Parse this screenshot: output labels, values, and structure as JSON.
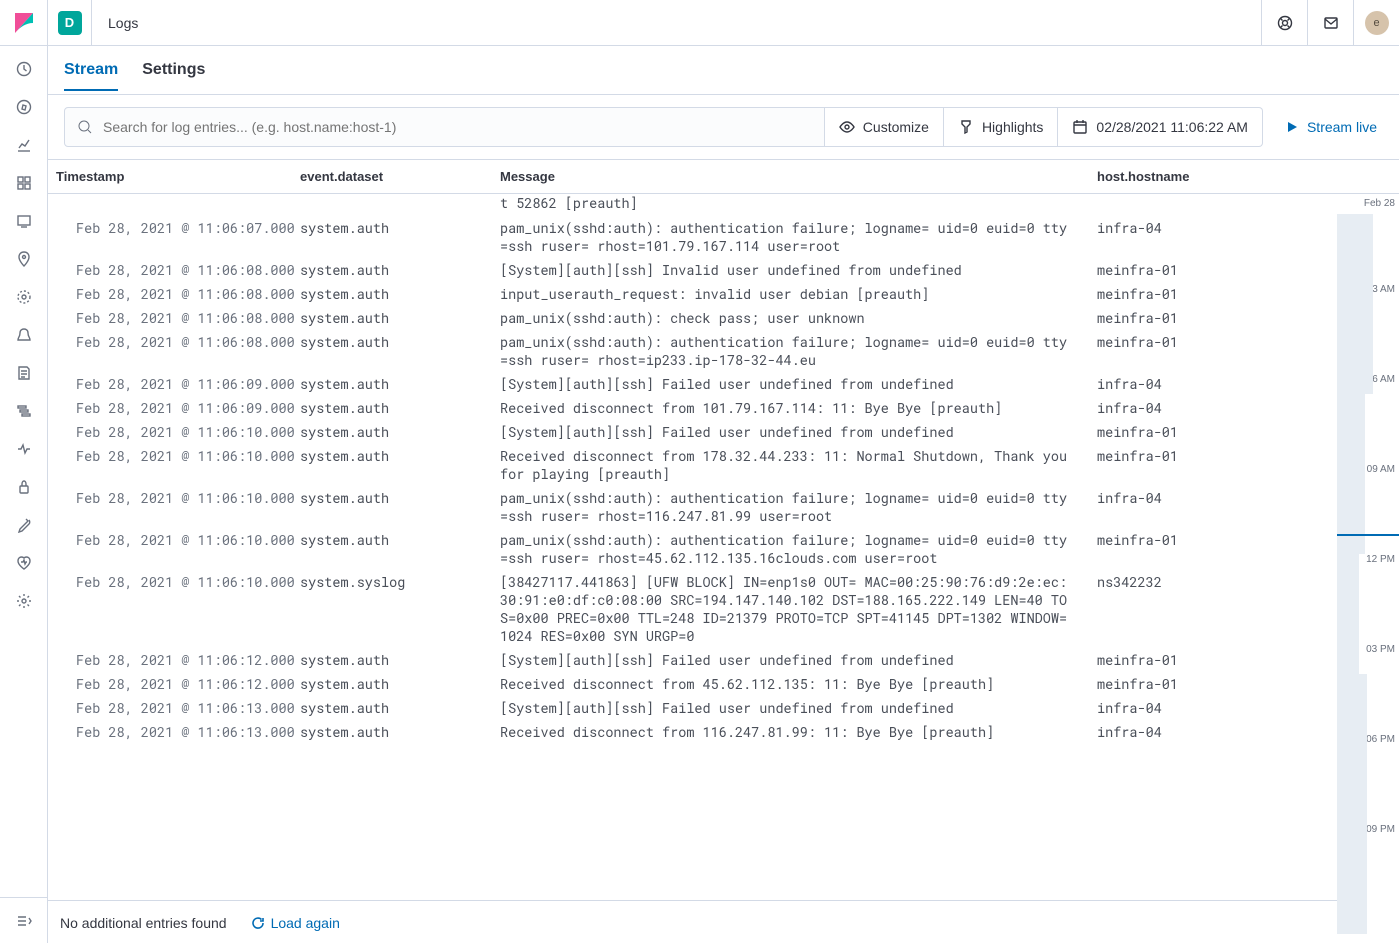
{
  "header": {
    "space_letter": "D",
    "title": "Logs",
    "avatar_letter": "e"
  },
  "tabs": {
    "stream": "Stream",
    "settings": "Settings"
  },
  "toolbar": {
    "search_placeholder": "Search for log entries... (e.g. host.name:host-1)",
    "customize": "Customize",
    "highlights": "Highlights",
    "date_value": "02/28/2021 11:06:22 AM",
    "stream_live": "Stream live"
  },
  "columns": {
    "ts": "Timestamp",
    "ds": "event.dataset",
    "msg": "Message",
    "host": "host.hostname"
  },
  "partial_row": {
    "msg": "t 52862 [preauth]"
  },
  "rows": [
    {
      "ts": "Feb 28, 2021 @ 11:06:07.000",
      "ds": "system.auth",
      "msg": "pam_unix(sshd:auth): authentication failure; logname= uid=0 euid=0 tty=ssh ruser= rhost=101.79.167.114  user=root",
      "host": "infra-04"
    },
    {
      "ts": "Feb 28, 2021 @ 11:06:08.000",
      "ds": "system.auth",
      "msg": "[System][auth][ssh] Invalid user undefined from undefined",
      "host": "meinfra-01"
    },
    {
      "ts": "Feb 28, 2021 @ 11:06:08.000",
      "ds": "system.auth",
      "msg": "input_userauth_request: invalid user debian [preauth]",
      "host": "meinfra-01"
    },
    {
      "ts": "Feb 28, 2021 @ 11:06:08.000",
      "ds": "system.auth",
      "msg": "pam_unix(sshd:auth): check pass; user unknown",
      "host": "meinfra-01"
    },
    {
      "ts": "Feb 28, 2021 @ 11:06:08.000",
      "ds": "system.auth",
      "msg": "pam_unix(sshd:auth): authentication failure; logname= uid=0 euid=0 tty=ssh ruser= rhost=ip233.ip-178-32-44.eu",
      "host": "meinfra-01"
    },
    {
      "ts": "Feb 28, 2021 @ 11:06:09.000",
      "ds": "system.auth",
      "msg": "[System][auth][ssh] Failed user undefined from undefined",
      "host": "infra-04"
    },
    {
      "ts": "Feb 28, 2021 @ 11:06:09.000",
      "ds": "system.auth",
      "msg": "Received disconnect from 101.79.167.114: 11: Bye Bye [preauth]",
      "host": "infra-04"
    },
    {
      "ts": "Feb 28, 2021 @ 11:06:10.000",
      "ds": "system.auth",
      "msg": "[System][auth][ssh] Failed user undefined from undefined",
      "host": "meinfra-01"
    },
    {
      "ts": "Feb 28, 2021 @ 11:06:10.000",
      "ds": "system.auth",
      "msg": "Received disconnect from 178.32.44.233: 11: Normal Shutdown, Thank you for playing [preauth]",
      "host": "meinfra-01"
    },
    {
      "ts": "Feb 28, 2021 @ 11:06:10.000",
      "ds": "system.auth",
      "msg": "pam_unix(sshd:auth): authentication failure; logname= uid=0 euid=0 tty=ssh ruser= rhost=116.247.81.99  user=root",
      "host": "infra-04"
    },
    {
      "ts": "Feb 28, 2021 @ 11:06:10.000",
      "ds": "system.auth",
      "msg": "pam_unix(sshd:auth): authentication failure; logname= uid=0 euid=0 tty=ssh ruser= rhost=45.62.112.135.16clouds.com  user=root",
      "host": "meinfra-01"
    },
    {
      "ts": "Feb 28, 2021 @ 11:06:10.000",
      "ds": "system.syslog",
      "msg": "[38427117.441863] [UFW BLOCK] IN=enp1s0 OUT= MAC=00:25:90:76:d9:2e:ec:30:91:e0:df:c0:08:00 SRC=194.147.140.102 DST=188.165.222.149 LEN=40 TOS=0x00 PREC=0x00 TTL=248 ID=21379 PROTO=TCP SPT=41145 DPT=1302 WINDOW=1024 RES=0x00 SYN URGP=0",
      "host": "ns342232"
    },
    {
      "ts": "Feb 28, 2021 @ 11:06:12.000",
      "ds": "system.auth",
      "msg": "[System][auth][ssh] Failed user undefined from undefined",
      "host": "meinfra-01"
    },
    {
      "ts": "Feb 28, 2021 @ 11:06:12.000",
      "ds": "system.auth",
      "msg": "Received disconnect from 45.62.112.135: 11: Bye Bye [preauth]",
      "host": "meinfra-01"
    },
    {
      "ts": "Feb 28, 2021 @ 11:06:13.000",
      "ds": "system.auth",
      "msg": "[System][auth][ssh] Failed user undefined from undefined",
      "host": "infra-04"
    },
    {
      "ts": "Feb 28, 2021 @ 11:06:13.000",
      "ds": "system.auth",
      "msg": "Received disconnect from 116.247.81.99: 11: Bye Bye [preauth]",
      "host": "infra-04"
    }
  ],
  "minimap": {
    "date_label": "Feb 28",
    "ticks": [
      "03 AM",
      "06 AM",
      "09 AM",
      "12 PM",
      "03 PM",
      "06 PM",
      "09 PM"
    ]
  },
  "footer": {
    "no_entries": "No additional entries found",
    "load_again": "Load again"
  }
}
